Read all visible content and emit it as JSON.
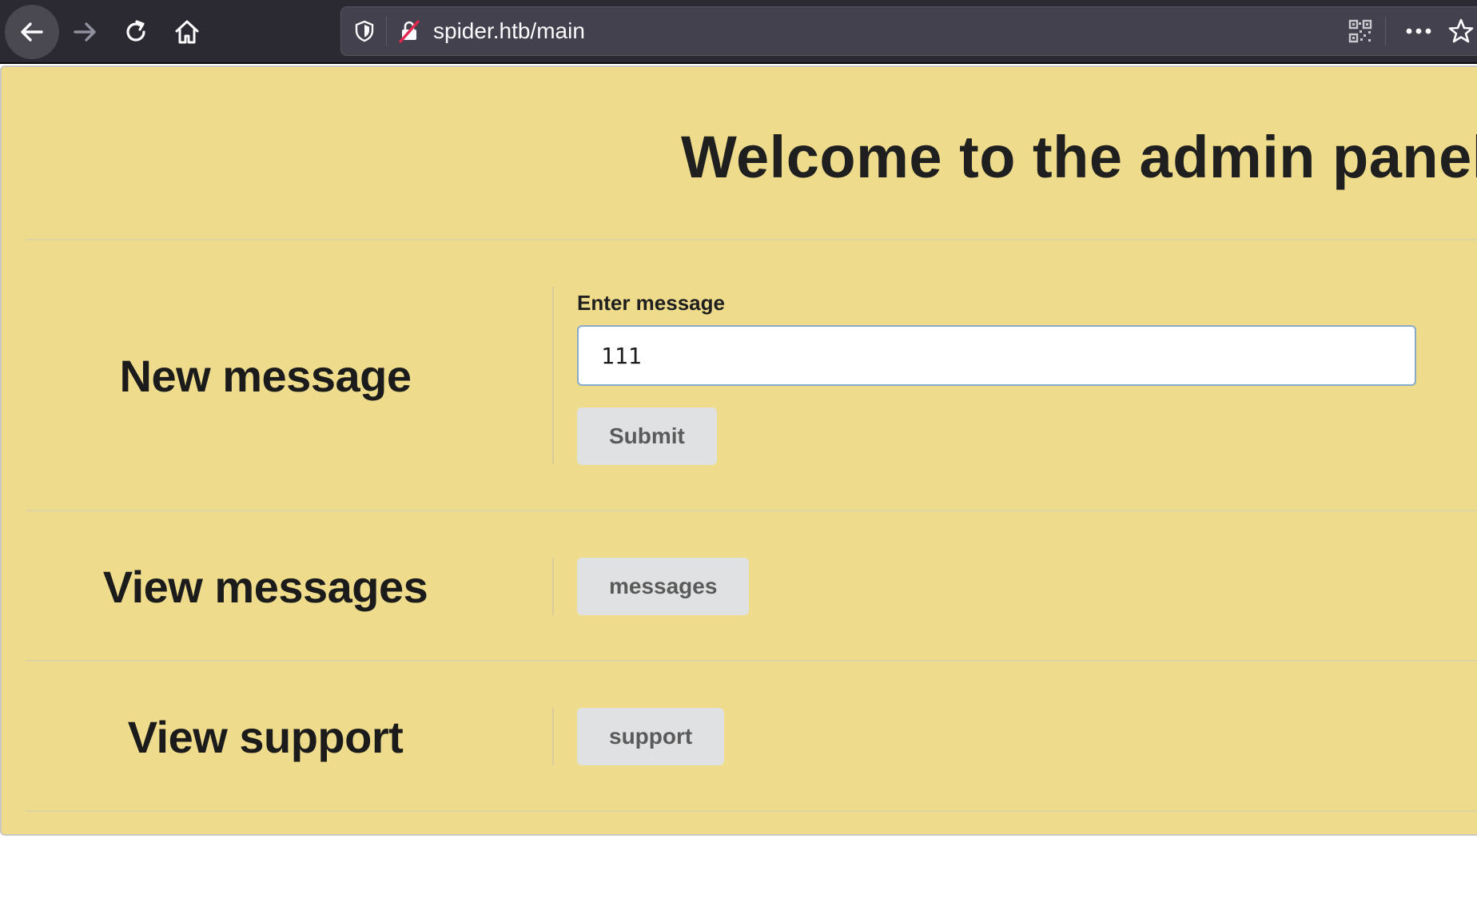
{
  "browser": {
    "url": "spider.htb/main",
    "icons": [
      "back-arrow-icon",
      "forward-arrow-icon",
      "reload-icon",
      "home-icon",
      "shield-icon",
      "insecure-lock-icon",
      "qr-code-icon",
      "more-dots-icon",
      "star-icon"
    ]
  },
  "page": {
    "title": "Welcome to the admin panel, c",
    "sections": {
      "new_message": {
        "heading": "New message",
        "field_label": "Enter message",
        "input_value": "111",
        "submit_label": "Submit"
      },
      "view_messages": {
        "heading": "View messages",
        "button_label": "messages"
      },
      "view_support": {
        "heading": "View support",
        "button_label": "support"
      }
    }
  },
  "colors": {
    "page_background": "#eedc8c",
    "toolbar_background": "#2b2a33",
    "urlbar_background": "#42414d",
    "button_background": "#e0e1e2",
    "input_border": "#8aaac9"
  }
}
